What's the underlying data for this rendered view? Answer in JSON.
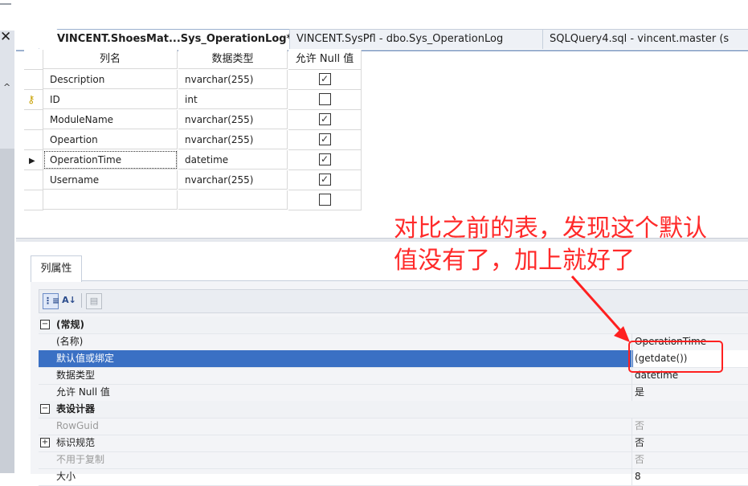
{
  "tabs": [
    {
      "label": "VINCENT.ShoesMat...Sys_OperationLog*",
      "active": true
    },
    {
      "label": "VINCENT.SysPfl - dbo.Sys_OperationLog",
      "active": false
    },
    {
      "label": "SQLQuery4.sql - vincent.master (s",
      "active": false
    }
  ],
  "grid": {
    "headers": {
      "column_name": "列名",
      "data_type": "数据类型",
      "allow_null": "允许 Null 值"
    },
    "rows": [
      {
        "name": "Description",
        "type": "nvarchar(255)",
        "allow_null": true,
        "key": false,
        "current": false
      },
      {
        "name": "ID",
        "type": "int",
        "allow_null": false,
        "key": true,
        "current": false
      },
      {
        "name": "ModuleName",
        "type": "nvarchar(255)",
        "allow_null": true,
        "key": false,
        "current": false
      },
      {
        "name": "Opeartion",
        "type": "nvarchar(255)",
        "allow_null": true,
        "key": false,
        "current": false
      },
      {
        "name": "OperationTime",
        "type": "datetime",
        "allow_null": true,
        "key": false,
        "current": true
      },
      {
        "name": "Username",
        "type": "nvarchar(255)",
        "allow_null": true,
        "key": false,
        "current": false
      },
      {
        "name": "",
        "type": "",
        "allow_null": false,
        "key": false,
        "current": false
      }
    ]
  },
  "annotation": {
    "line1": "对比之前的表，发现这个默认",
    "line2": "值没有了，加上就好了",
    "color": "#ff2a2a"
  },
  "properties": {
    "tab_label": "列属性",
    "toolbar": {
      "categorized_icon": "categorized-icon",
      "alphabetical_icon": "sort-az-icon",
      "pages_icon": "property-pages-icon"
    },
    "general_category": "(常规)",
    "general_items": [
      {
        "name": "(名称)",
        "value": "OperationTime",
        "grey": false,
        "selected": false
      },
      {
        "name": "默认值或绑定",
        "value": "(getdate())",
        "grey": false,
        "selected": true
      },
      {
        "name": "数据类型",
        "value": "datetime",
        "grey": false,
        "selected": false
      },
      {
        "name": "允许 Null 值",
        "value": "是",
        "grey": false,
        "selected": false
      }
    ],
    "designer_category": "表设计器",
    "designer_items": [
      {
        "name": "RowGuid",
        "value": "否",
        "grey": true,
        "expandable": false
      },
      {
        "name": "标识规范",
        "value": "否",
        "grey": false,
        "expandable": true
      },
      {
        "name": "不用于复制",
        "value": "否",
        "grey": true,
        "expandable": false
      },
      {
        "name": "大小",
        "value": "8",
        "grey": false,
        "expandable": false
      }
    ]
  }
}
